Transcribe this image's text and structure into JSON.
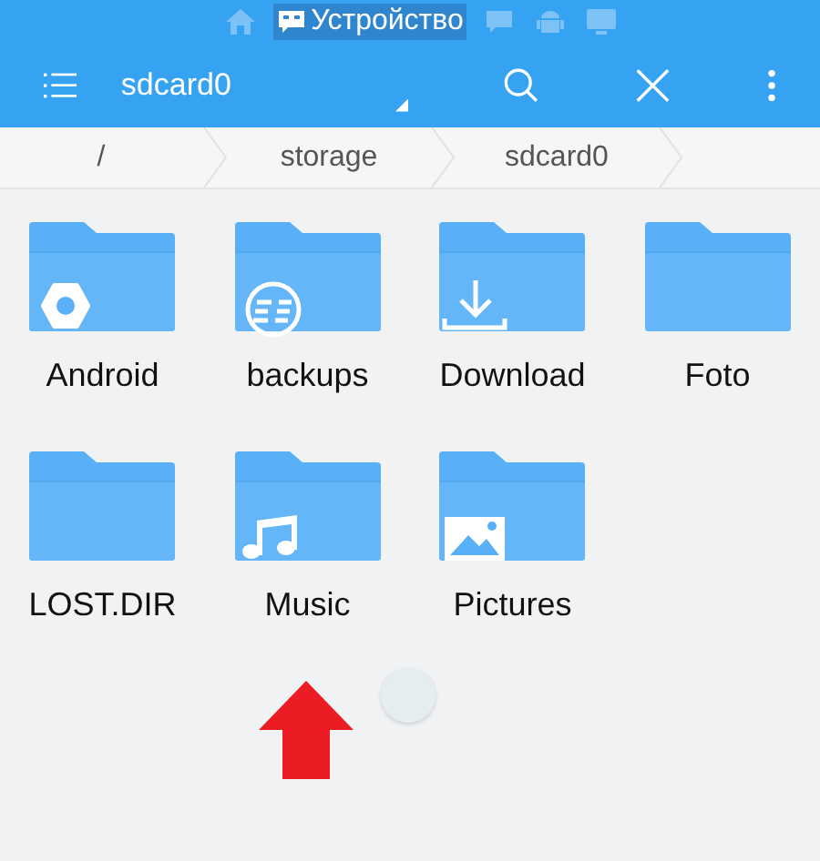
{
  "location_tabs": [
    {
      "kind": "home",
      "selected": false
    },
    {
      "kind": "device",
      "label": "Устройство",
      "selected": true
    },
    {
      "kind": "sdcard",
      "selected": false
    },
    {
      "kind": "android",
      "selected": false
    },
    {
      "kind": "network",
      "selected": false
    }
  ],
  "toolbar": {
    "title": "sdcard0"
  },
  "breadcrumb": [
    "/",
    "storage",
    "sdcard0"
  ],
  "folders": [
    {
      "name": "Android",
      "kind": "settings"
    },
    {
      "name": "backups",
      "kind": "es"
    },
    {
      "name": "Download",
      "kind": "download"
    },
    {
      "name": "Foto",
      "kind": "plain"
    },
    {
      "name": "LOST.DIR",
      "kind": "plain"
    },
    {
      "name": "Music",
      "kind": "music"
    },
    {
      "name": "Pictures",
      "kind": "picture"
    }
  ]
}
